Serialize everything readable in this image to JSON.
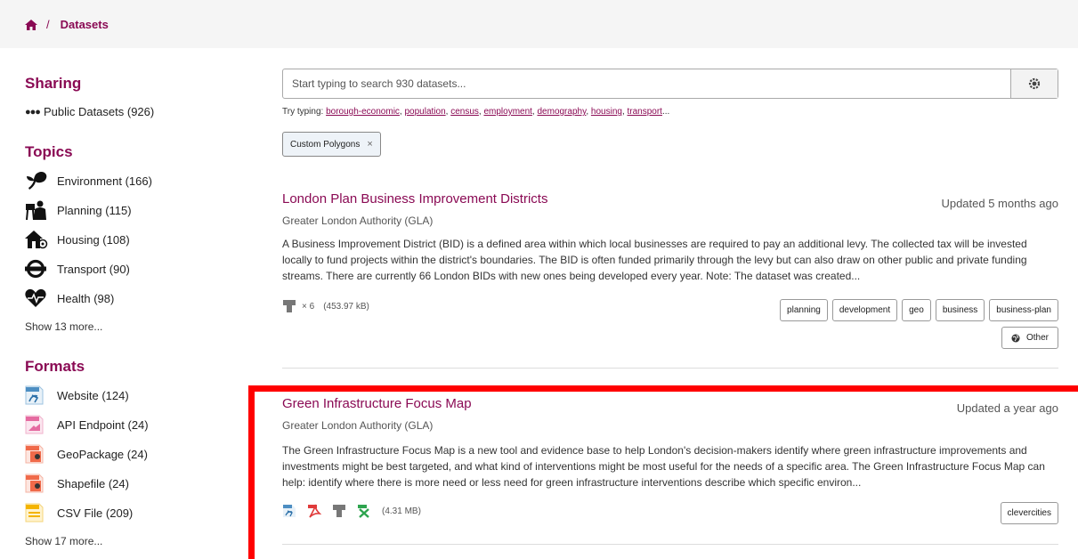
{
  "breadcrumb": {
    "home_icon": "home-icon",
    "separator": "/",
    "current": "Datasets"
  },
  "sidebar": {
    "sharing": {
      "heading": "Sharing",
      "item": {
        "icon": "dots-icon",
        "label": "Public Datasets (926)"
      }
    },
    "topics": {
      "heading": "Topics",
      "items": [
        {
          "icon": "environment-icon",
          "label": "Environment (166)"
        },
        {
          "icon": "planning-icon",
          "label": "Planning (115)"
        },
        {
          "icon": "housing-icon",
          "label": "Housing (108)"
        },
        {
          "icon": "transport-icon",
          "label": "Transport (90)"
        },
        {
          "icon": "health-icon",
          "label": "Health (98)"
        }
      ],
      "more": "Show 13 more..."
    },
    "formats": {
      "heading": "Formats",
      "items": [
        {
          "icon": "website-icon",
          "label": "Website (124)"
        },
        {
          "icon": "api-icon",
          "label": "API Endpoint (24)"
        },
        {
          "icon": "geopackage-icon",
          "label": "GeoPackage (24)"
        },
        {
          "icon": "shapefile-icon",
          "label": "Shapefile (24)"
        },
        {
          "icon": "csv-icon",
          "label": "CSV File (209)"
        }
      ],
      "more": "Show 17 more..."
    }
  },
  "search": {
    "placeholder": "Start typing to search 930 datasets...",
    "button_icon": "settings-icon",
    "try_label": "Try typing:",
    "suggestions": [
      "borough-economic",
      "population",
      "census",
      "employment",
      "demography",
      "housing",
      "transport"
    ],
    "ellipsis": "..."
  },
  "filter_chip": {
    "label": "Custom Polygons",
    "remove": "×"
  },
  "results": [
    {
      "title": "London Plan Business Improvement Districts",
      "updated": "Updated 5 months ago",
      "org": "Greater London Authority (GLA)",
      "description": "A Business Improvement District (BID) is a defined area within which local businesses are required to pay an additional levy. The collected tax will be invested locally to fund projects within the district's boundaries. The BID is often funded primarily through the levy but can also draw on other public and private funding streams. There are currently 66 London BIDs with new ones being developed every year. Note: The dataset was created...",
      "files_count": "× 6",
      "size": "(453.97 kB)",
      "tags": [
        "planning",
        "development",
        "geo",
        "business",
        "business-plan"
      ],
      "licence": "Other"
    },
    {
      "title": "Green Infrastructure Focus Map",
      "updated": "Updated a year ago",
      "org": "Greater London Authority (GLA)",
      "description": "The Green Infrastructure Focus Map is a new tool and evidence base to help London's decision-makers identify where green infrastructure improvements and investments might be best targeted, and what kind of interventions might be most useful for the needs of a specific area. The Green Infrastructure Focus Map can help: identify where there is more need or less need for green infrastructure interventions describe which specific environ...",
      "formats": [
        "website-icon",
        "pdf-icon",
        "file-icon",
        "spreadsheet-icon"
      ],
      "size": "(4.31 MB)",
      "tags": [
        "clevercities"
      ]
    }
  ],
  "colors": {
    "brand": "#8a0a54",
    "highlight": "#ff0000"
  }
}
